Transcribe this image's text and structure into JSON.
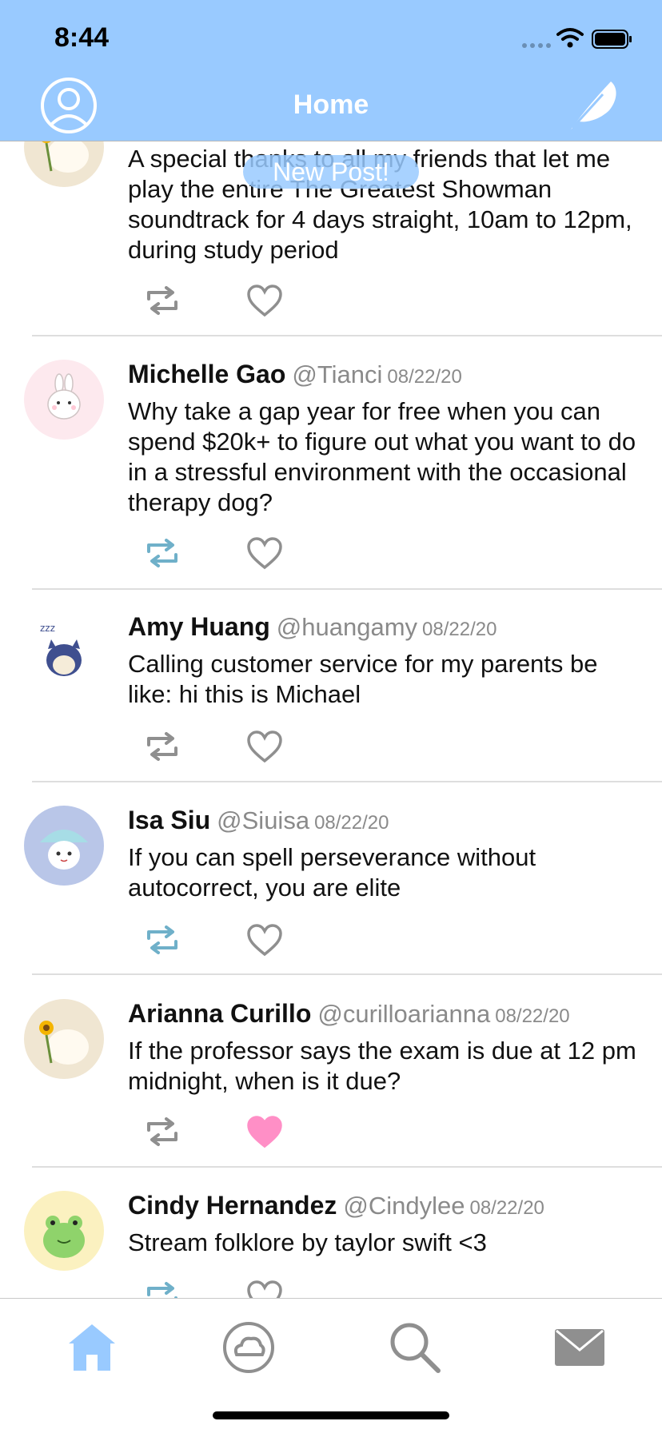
{
  "status_bar": {
    "time": "8:44"
  },
  "nav": {
    "title": "Home"
  },
  "new_post_label": "New Post!",
  "colors": {
    "accent": "#99caff",
    "retweet_active": "#6fb0c9",
    "liked": "#ff8fc6",
    "icon_gray": "#8f8f8f"
  },
  "feed": {
    "posts": [
      {
        "name": "",
        "handle": "",
        "date": "",
        "text": "A special thanks to all my friends that let me play the entire The Greatest Showman soundtrack for 4 days straight, 10am to 12pm, during study period",
        "avatar": "bunny-sunflower",
        "retweeted": false,
        "liked": false
      },
      {
        "name": "Michelle Gao",
        "handle": "@Tianci",
        "date": "08/22/20",
        "text": "Why take a gap year for free when you can spend $20k+ to figure out what you want to do in a stressful environment with the occasional therapy dog?",
        "avatar": "mochi-bunny",
        "retweeted": true,
        "liked": false
      },
      {
        "name": "Amy Huang",
        "handle": "@huangamy",
        "date": "08/22/20",
        "text": "Calling customer service for my parents be like: hi this is Michael",
        "avatar": "sleepy-cat",
        "retweeted": false,
        "liked": false
      },
      {
        "name": "Isa Siu",
        "handle": "@Siuisa",
        "date": "08/22/20",
        "text": "If you can spell perseverance without autocorrect, you are elite",
        "avatar": "mushroom-creature",
        "retweeted": true,
        "liked": false
      },
      {
        "name": "Arianna Curillo",
        "handle": "@curilloarianna",
        "date": "08/22/20",
        "text": "If the professor says the exam is due at 12 pm midnight, when is it due?",
        "avatar": "bunny-sunflower",
        "retweeted": false,
        "liked": true
      },
      {
        "name": "Cindy Hernandez",
        "handle": "@Cindylee",
        "date": "08/22/20",
        "text": "Stream folklore by taylor swift <3",
        "avatar": "frog",
        "retweeted": true,
        "liked": false
      }
    ]
  },
  "tabs": [
    {
      "icon": "home-icon",
      "active": true
    },
    {
      "icon": "cloud-icon",
      "active": false
    },
    {
      "icon": "search-icon",
      "active": false
    },
    {
      "icon": "mail-icon",
      "active": false
    }
  ]
}
